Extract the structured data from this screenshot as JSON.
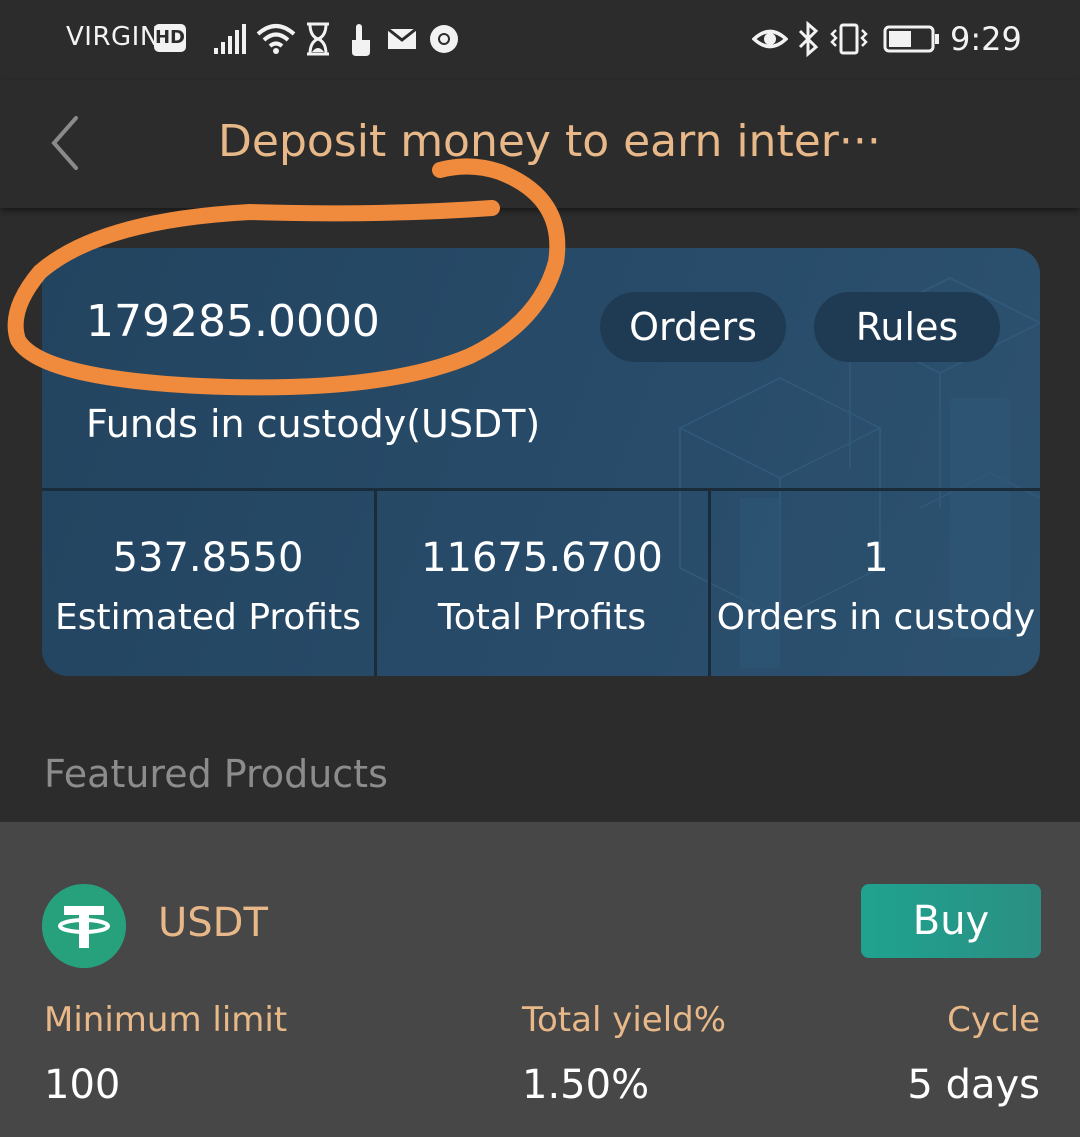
{
  "status_bar": {
    "carrier": "VIRGIN",
    "network_badge": "HD",
    "time": "9:29",
    "icons": [
      "signal-icon",
      "wifi-icon",
      "hourglass-icon",
      "touch-icon",
      "mail-icon",
      "chrome-icon",
      "eye-icon",
      "bluetooth-icon",
      "vibrate-icon",
      "battery-icon"
    ]
  },
  "header": {
    "title": "Deposit money to earn inter···",
    "back_icon": "chevron-left-icon"
  },
  "summary": {
    "funds_value": "179285.0000",
    "funds_label": "Funds in custody(USDT)",
    "orders_button": "Orders",
    "rules_button": "Rules",
    "stats": [
      {
        "value": "537.8550",
        "label": "Estimated Profits"
      },
      {
        "value": "11675.6700",
        "label": "Total Profits"
      },
      {
        "value": "1",
        "label": "Orders in custody"
      }
    ]
  },
  "section_title": "Featured Products",
  "product": {
    "coin": "USDT",
    "coin_icon": "tether-icon",
    "buy_button": "Buy",
    "min_limit_label": "Minimum limit",
    "min_limit_value": "100",
    "yield_label": "Total yield%",
    "yield_value": "1.50%",
    "cycle_label": "Cycle",
    "cycle_value": "5 days"
  },
  "colors": {
    "accent": "#e8b889",
    "card": "#264866",
    "buy": "#1fa38f",
    "tether": "#27a17c",
    "annotation": "#f08a3c"
  }
}
